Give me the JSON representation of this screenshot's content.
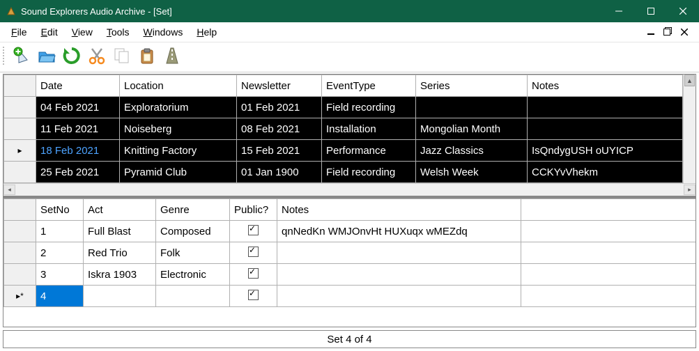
{
  "window": {
    "title": "Sound Explorers Audio Archive - [Set]"
  },
  "menu": {
    "file": "File",
    "edit": "Edit",
    "view": "View",
    "tools": "Tools",
    "windows": "Windows",
    "help": "Help"
  },
  "grid1": {
    "headers": {
      "date": "Date",
      "location": "Location",
      "newsletter": "Newsletter",
      "eventtype": "EventType",
      "series": "Series",
      "notes": "Notes"
    },
    "rows": [
      {
        "date": "04 Feb 2021",
        "location": "Exploratorium",
        "newsletter": "01 Feb 2021",
        "eventtype": "Field recording",
        "series": "",
        "notes": ""
      },
      {
        "date": "11 Feb 2021",
        "location": "Noiseberg",
        "newsletter": "08 Feb 2021",
        "eventtype": "Installation",
        "series": "Mongolian Month",
        "notes": ""
      },
      {
        "date": "18 Feb 2021",
        "location": "Knitting Factory",
        "newsletter": "15 Feb 2021",
        "eventtype": "Performance",
        "series": "Jazz Classics",
        "notes": "IsQndygUSH oUYICP"
      },
      {
        "date": "25 Feb 2021",
        "location": "Pyramid Club",
        "newsletter": "01 Jan 1900",
        "eventtype": "Field recording",
        "series": "Welsh Week",
        "notes": "CCKYvVhekm"
      }
    ],
    "current_row_marker": "▸",
    "current_row_index": 2
  },
  "grid2": {
    "headers": {
      "setno": "SetNo",
      "act": "Act",
      "genre": "Genre",
      "public": "Public?",
      "notes": "Notes"
    },
    "rows": [
      {
        "setno": "1",
        "act": "Full Blast",
        "genre": "Composed",
        "public": true,
        "notes": "qnNedKn WMJOnvHt HUXuqx wMEZdq"
      },
      {
        "setno": "2",
        "act": "Red Trio",
        "genre": "Folk",
        "public": true,
        "notes": ""
      },
      {
        "setno": "3",
        "act": "Iskra 1903",
        "genre": "Electronic",
        "public": true,
        "notes": ""
      }
    ],
    "new_row": {
      "setno": "4",
      "public": true
    },
    "new_row_marker": "▸*"
  },
  "status": "Set 4 of 4"
}
